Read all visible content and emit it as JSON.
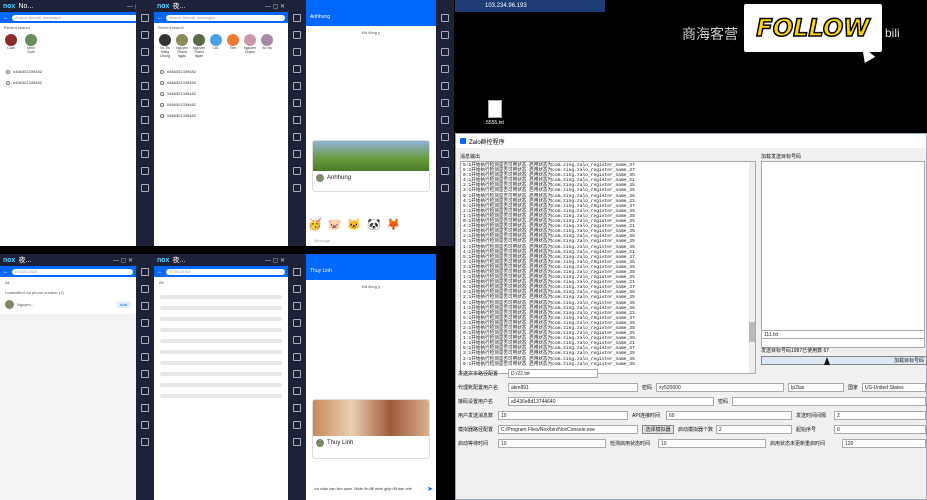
{
  "top_right_text": "商海客营",
  "follow_label": "FOLLOW",
  "bili_label": "bili",
  "remote_title": "103.234.96.193",
  "desktop_file_label": "5555.txt",
  "emulators": {
    "logo": "nox",
    "title_1": "No...",
    "title_2": "夜...",
    "title_7": "夜...",
    "title_8": "夜..."
  },
  "phone1": {
    "search_placeholder": "Search friends, messages",
    "recent_label": "Recent search",
    "recent": [
      "Cuơi",
      "Minh Nuhi"
    ],
    "history": [
      "0466301339482",
      "0466301339482"
    ]
  },
  "phone2": {
    "search_placeholder": "Search friends, messages",
    "recent_label": "Recent search",
    "recent": [
      "Vu Thi Hang Chung",
      "Nguyen Thanh Ngan",
      "Nguyen Thanh Ngan",
      "LiE",
      "Tien",
      "Nguyen Duyen",
      "Sư trụ"
    ],
    "history": [
      "0466301339482",
      "0466301339482",
      "0466301339482",
      "0466301339482",
      "0466301339482"
    ]
  },
  "phone3": {
    "header_name": "Anhhung",
    "header_sub": "Đã đồng ý",
    "card_text": "Anhhung",
    "input_placeholder": "Message"
  },
  "phone4": {
    "search_text": "0730313925",
    "tab": "All",
    "result_label": "Lookedfind via phone number (1)",
    "result_name": "Nguyen...",
    "add_label": "Add"
  },
  "phone5": {
    "search_text": "0735131947",
    "tab": "All"
  },
  "phone6": {
    "header_name": "Thuy Linh",
    "header_sub": "Đã đồng ý",
    "card_text": "Thuy Linh",
    "input_text": "xin chào bạn làm quen. Nhắn tin để mình giúp đỡ bạn nhé"
  },
  "tool": {
    "title": "Zalo群控程序",
    "log_label": "消息输出",
    "log_lines": [
      "5:1开始执行检测是否可用状态 启用状态为com.zing.zalo_register_name_37",
      "5:1开始执行检测是否可用状态 启用状态为com.zing.zalo_register_name_37",
      "0:1开始执行检测是否可用状态 启用状态为com.zing.zalo_register_name_35",
      "4:1开始执行检测是否可用状态 启用状态为com.zing.zalo_register_name_21",
      "2:1开始执行检测是否可用状态 启用状态为com.zing.zalo_register_name_35",
      "3:1开始执行检测是否可用状态 启用状态为com.zing.zalo_register_name_35",
      "0:1开始执行检测是否可用状态 启用状态为com.zing.zalo_register_name_35",
      "4:1开始执行检测是否可用状态 启用状态为com.zing.zalo_register_name_21",
      "5:1开始执行检测是否可用状态 启用状态为com.zing.zalo_register_name_37",
      "2:1开始执行检测是否可用状态 启用状态为com.zing.zalo_register_name_35",
      "1:1开始执行检测是否可用状态 启用状态为com.zing.zalo_register_name_35",
      "0:1开始执行检测是否可用状态 启用状态为com.zing.zalo_register_name_35",
      "4:1开始执行检测是否可用状态 启用状态为com.zing.zalo_register_name_21",
      "3:1开始执行检测是否可用状态 启用状态为com.zing.zalo_register_name_35",
      "2:1开始执行检测是否可用状态 启用状态为com.zing.zalo_register_name_35",
      "0:1开始执行检测是否可用状态 启用状态为com.zing.zalo_register_name_35",
      "1:1开始执行检测是否可用状态 启用状态为com.zing.zalo_register_name_35",
      "4:1开始执行检测是否可用状态 启用状态为com.zing.zalo_register_name_21",
      "5:1开始执行检测是否可用状态 启用状态为com.zing.zalo_register_name_37",
      "3:1开始执行检测是否可用状态 启用状态为com.zing.zalo_register_name_35",
      "2:1开始执行检测是否可用状态 启用状态为com.zing.zalo_register_name_35",
      "0:1开始执行检测是否可用状态 启用状态为com.zing.zalo_register_name_35",
      "1:1开始执行检测是否可用状态 启用状态为com.zing.zalo_register_name_35",
      "4:1开始执行检测是否可用状态 启用状态为com.zing.zalo_register_name_21",
      "5:1开始执行检测是否可用状态 启用状态为com.zing.zalo_register_name_37",
      "3:1开始执行检测是否可用状态 启用状态为com.zing.zalo_register_name_35",
      "2:1开始执行检测是否可用状态 启用状态为com.zing.zalo_register_name_35",
      "0:1开始执行检测是否可用状态 启用状态为com.zing.zalo_register_name_35",
      "1:1开始执行检测是否可用状态 启用状态为com.zing.zalo_register_name_35",
      "4:1开始执行检测是否可用状态 启用状态为com.zing.zalo_register_name_21",
      "5:1开始执行检测是否可用状态 启用状态为com.zing.zalo_register_name_37",
      "3:1开始执行检测是否可用状态 启用状态为com.zing.zalo_register_name_35",
      "2:1开始执行检测是否可用状态 启用状态为com.zing.zalo_register_name_35",
      "0:1开始执行检测是否可用状态 启用状态为com.zing.zalo_register_name_35",
      "1:1开始执行检测是否可用状态 启用状态为com.zing.zalo_register_name_35",
      "4:1开始执行检测是否可用状态 启用状态为com.zing.zalo_register_name_21",
      "5:1开始执行检测是否可用状态 启用状态为com.zing.zalo_register_name_37",
      "3:1开始执行检测是否可用状态 启用状态为com.zing.zalo_register_name_35",
      "2:1开始执行检测是否可用状态 启用状态为com.zing.zalo_register_name_35",
      "0:1开始执行检测是否可用状态 启用状态为com.zing.zalo_register_name_35"
    ],
    "target_label": "加载发送目标号码",
    "target_value": "111.txt",
    "status": "发送目标号码1987已使用数 67",
    "load_button": "加载目标号码",
    "send_text_label": "发送文本路径配置",
    "send_text_value": "D:/22.txt",
    "proxy_user_label": "代理账配置用户名",
    "proxy_user_value": "akm891",
    "password_label": "密码",
    "password_value": "xy520600",
    "proxy_type": "Ip2las",
    "country_label": "国家",
    "country_value": "US-United States",
    "note_label": "接码设置用户名",
    "note_value": "a5436e8d13744640",
    "note_pwd_label": "密码",
    "friend_label": "用户发送消息数",
    "friend_value": "10",
    "api_label": "API连接时间",
    "api_value": "60",
    "interval_label": "发送时间间隔",
    "interval_value": "2",
    "emu_path_label": "模拟器路径配置",
    "emu_path_value": "C:/Program Files/Nox/bin/NoxConsole.exe",
    "choose_emu_button": "选择模拟器",
    "emu_count_label": "启动模拟器个数",
    "emu_count_value": "2",
    "start_index_label": "起始序号",
    "start_index_value": "0",
    "startup_time_label": "启动等待时间",
    "startup_time_value": "10",
    "check_time_label": "检测启用状态时间",
    "check_time_value": "10",
    "restart_time_label": "启用状态未更新重启时间",
    "restart_time_value": "120"
  }
}
